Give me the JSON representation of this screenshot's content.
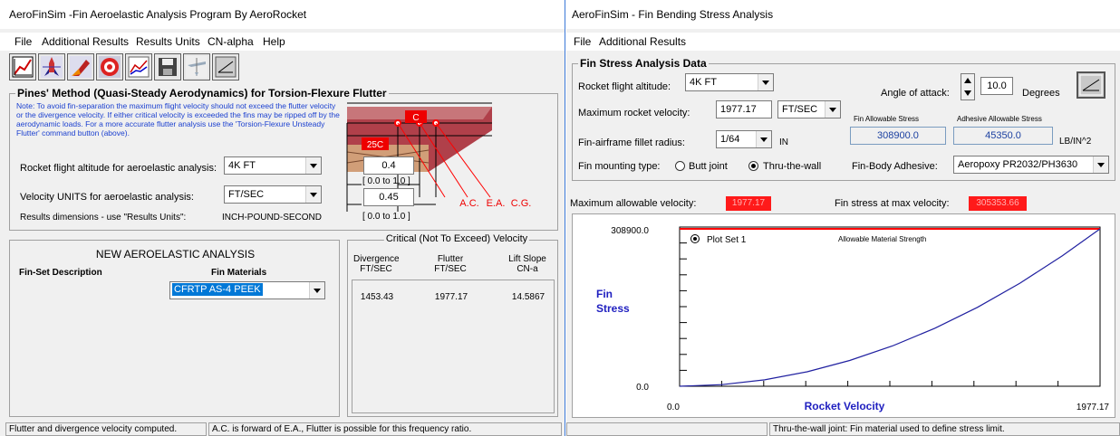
{
  "left": {
    "title": "AeroFinSim -Fin Aeroelastic Analysis Program By AeroRocket",
    "menu": [
      "File",
      "Additional Results",
      "Results Units",
      "CN-alpha",
      "Help"
    ],
    "toolbar_icons": [
      "plot-icon",
      "rocket-icon",
      "fin-icon",
      "target-icon",
      "graph-icon",
      "save-icon",
      "plane-icon",
      "flutter-icon"
    ],
    "pines": {
      "heading": "Pines' Method (Quasi-Steady Aerodynamics) for Torsion-Flexure Flutter",
      "note": "Note: To avoid fin-separation the maximum flight velocity should not exceed the flutter velocity or the divergence velocity. If either critical velocity is exceeded the fins may be ripped off by the aerodynamic loads. For a more accurate flutter analysis use the 'Torsion-Flexure Unsteady Flutter' command button (above).",
      "altitude_label": "Rocket flight altitude for aeroelastic analysis:",
      "altitude_value": "4K FT",
      "units_label": "Velocity UNITS for aeroelastic analysis:",
      "units_value": "FT/SEC",
      "dims_label": "Results dimensions - use \"Results Units\":",
      "dims_value": "INCH-POUND-SECOND",
      "diagram": {
        "c_label": "C",
        "c25_label": "25C",
        "input1": "0.4",
        "range1": "[ 0.0 to 1.0 ]",
        "input2": "0.45",
        "range2": "[ 0.0 to 1.0 ]",
        "ac": "A.C.",
        "ea": "E.A.",
        "cg": "C.G."
      }
    },
    "analysis": {
      "title": "NEW AEROELASTIC ANALYSIS",
      "desc_label": "Fin-Set Description",
      "materials_label": "Fin Materials",
      "material_value": "CFRTP AS-4 PEEK"
    },
    "critical": {
      "heading": "Critical (Not To Exceed) Velocity",
      "headers": [
        [
          "Divergence",
          "FT/SEC"
        ],
        [
          "Flutter",
          "FT/SEC"
        ],
        [
          "Lift Slope",
          "CN-a"
        ]
      ],
      "values": [
        "1453.43",
        "1977.17",
        "14.5867"
      ]
    },
    "status": [
      "Flutter and divergence velocity computed.",
      "A.C. is forward of E.A., Flutter is possible for this frequency ratio."
    ]
  },
  "right": {
    "title": "AeroFinSim - Fin Bending Stress Analysis",
    "menu": [
      "File",
      "Additional Results"
    ],
    "stress": {
      "heading": "Fin Stress Analysis Data",
      "altitude_label": "Rocket flight altitude:",
      "altitude_value": "4K FT",
      "velocity_label": "Maximum rocket velocity:",
      "velocity_value": "1977.17",
      "velocity_unit": "FT/SEC",
      "fillet_label": "Fin-airframe fillet radius:",
      "fillet_value": "1/64",
      "fillet_unit": "IN",
      "mounting_label": "Fin mounting type:",
      "butt_label": "Butt joint",
      "thru_label": "Thru-the-wall",
      "angle_label": "Angle of attack:",
      "angle_value": "10.0",
      "angle_unit": "Degrees",
      "allow_label": "Fin Allowable Stress",
      "allow_value": "308900.0",
      "adh_label": "Adhesive Allowable Stress",
      "adh_value": "45350.0",
      "stress_unit": "LB/IN^2",
      "adhesive_label": "Fin-Body Adhesive:",
      "adhesive_value": "Aeropoxy PR2032/PH3630"
    },
    "max_vel_label": "Maximum allowable velocity:",
    "max_vel_value": "1977.17",
    "stress_max_label": "Fin stress at max velocity:",
    "stress_max_value": "305353.66",
    "status": [
      "",
      "Thru-the-wall joint: Fin material used to define stress limit."
    ]
  },
  "chart_data": {
    "type": "line",
    "title": "",
    "xlabel": "Rocket Velocity",
    "ylabel": "Fin Stress",
    "xlim": [
      0.0,
      1977.17
    ],
    "ylim": [
      0.0,
      308900.0
    ],
    "x_tick_labels": [
      "0.0",
      "1977.17"
    ],
    "y_tick_labels": [
      "0.0",
      "308900.0"
    ],
    "legend": "Plot Set 1",
    "reference_label": "Allowable Material Strength",
    "reference_value": 308900.0,
    "reference_color": "#ff0000",
    "series_color": "#2020a0",
    "series": [
      {
        "name": "Plot Set 1",
        "x": [
          0,
          200,
          400,
          600,
          800,
          1000,
          1200,
          1400,
          1600,
          1800,
          1977.17
        ],
        "y": [
          0,
          3124,
          12495,
          28114,
          49979,
          78093,
          112454,
          153062,
          199918,
          253023,
          305354
        ]
      }
    ]
  }
}
